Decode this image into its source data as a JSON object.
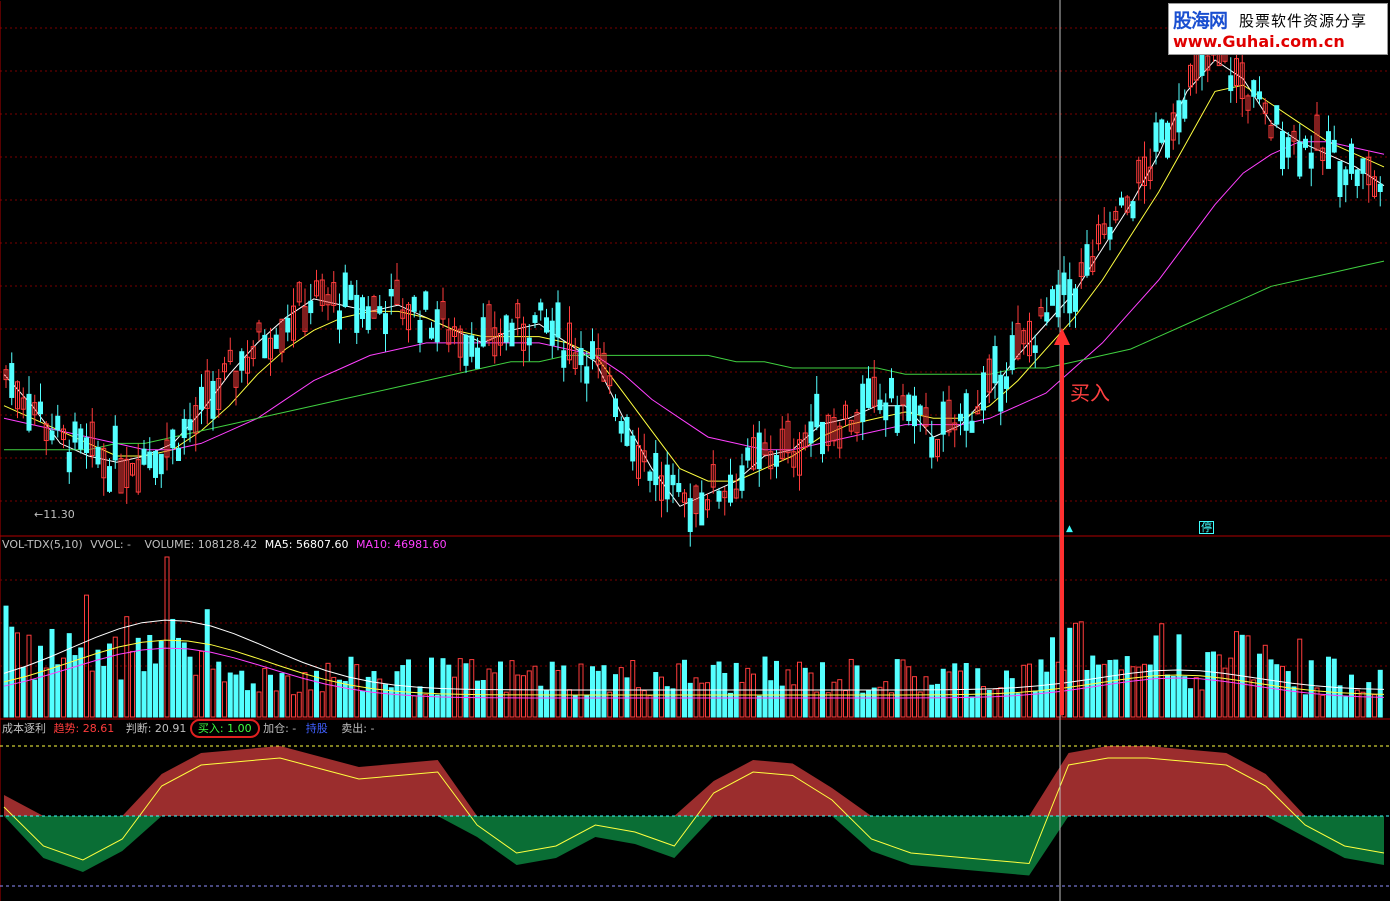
{
  "watermark": {
    "brand": "股海网",
    "tagline": "股票软件资源分享",
    "url": "www.Guhai.com.cn"
  },
  "annotations": {
    "buy_arrow_label": "买入",
    "low_price_label": "←11.30",
    "limit_mark": "停",
    "up_mark": "▲"
  },
  "volume_panel": {
    "name": "VOL-TDX(5,10)",
    "vvol": "VVOL: -",
    "volume": "VOLUME: 108128.42",
    "ma5": "MA5: 56807.60",
    "ma10": "MA10: 46981.60"
  },
  "indicator_panel": {
    "name": "成本逐利",
    "trend_label": "趋势: 28.61",
    "judge_label": "判断: 20.91",
    "buy_label": "买入: 1.00",
    "add_label": "加仓: -",
    "hold_label": "持股",
    "sell_label": "卖出: -"
  },
  "colors": {
    "background": "#000000",
    "up_candle": "#ff3c3c",
    "down_candle": "#54ffff",
    "ma_white": "#ffffff",
    "ma_yellow": "#ffff40",
    "ma_magenta": "#ff40ff",
    "ma_green": "#40d040",
    "grid": "#7a0000",
    "positive_fill": "#9b2d2d",
    "negative_fill": "#0a6e35"
  },
  "chart_data": [
    {
      "type": "candlestick",
      "title": "",
      "price_low_marked": 11.3,
      "series": [
        {
          "name": "MA-white",
          "values": [
            0.85,
            0.8,
            0.74,
            0.72,
            0.71,
            0.72,
            0.74,
            0.79,
            0.85,
            0.9,
            0.94,
            0.97,
            0.96,
            0.95,
            0.96,
            0.94,
            0.92,
            0.9,
            0.92,
            0.93,
            0.9,
            0.87,
            0.78,
            0.7,
            0.64,
            0.66,
            0.68,
            0.72,
            0.73,
            0.77,
            0.78,
            0.8,
            0.8,
            0.75,
            0.77,
            0.82,
            0.88,
            0.93,
            0.98,
            1.05,
            1.12,
            1.2,
            1.3,
            1.35,
            1.32,
            1.25,
            1.22,
            1.2,
            1.18,
            1.15
          ]
        },
        {
          "name": "MA-yellow",
          "values": [
            0.8,
            0.78,
            0.76,
            0.74,
            0.72,
            0.72,
            0.73,
            0.76,
            0.8,
            0.85,
            0.89,
            0.92,
            0.94,
            0.95,
            0.95,
            0.94,
            0.92,
            0.91,
            0.91,
            0.91,
            0.9,
            0.88,
            0.82,
            0.76,
            0.7,
            0.68,
            0.68,
            0.7,
            0.72,
            0.75,
            0.77,
            0.78,
            0.79,
            0.78,
            0.78,
            0.8,
            0.84,
            0.89,
            0.94,
            1.0,
            1.07,
            1.14,
            1.22,
            1.3,
            1.31,
            1.28,
            1.25,
            1.22,
            1.2,
            1.18
          ]
        },
        {
          "name": "MA-magenta",
          "values": [
            0.78,
            0.77,
            0.76,
            0.75,
            0.74,
            0.73,
            0.73,
            0.74,
            0.76,
            0.78,
            0.81,
            0.84,
            0.86,
            0.88,
            0.89,
            0.9,
            0.9,
            0.9,
            0.9,
            0.9,
            0.89,
            0.88,
            0.85,
            0.81,
            0.78,
            0.75,
            0.74,
            0.73,
            0.73,
            0.74,
            0.75,
            0.76,
            0.77,
            0.77,
            0.77,
            0.78,
            0.8,
            0.82,
            0.86,
            0.9,
            0.95,
            1.0,
            1.06,
            1.12,
            1.17,
            1.2,
            1.22,
            1.22,
            1.21,
            1.2
          ]
        },
        {
          "name": "MA-green",
          "values": [
            0.73,
            0.73,
            0.73,
            0.73,
            0.74,
            0.74,
            0.75,
            0.76,
            0.77,
            0.78,
            0.79,
            0.8,
            0.81,
            0.82,
            0.83,
            0.84,
            0.85,
            0.86,
            0.87,
            0.87,
            0.88,
            0.88,
            0.88,
            0.88,
            0.88,
            0.88,
            0.87,
            0.87,
            0.86,
            0.86,
            0.86,
            0.86,
            0.85,
            0.85,
            0.85,
            0.85,
            0.86,
            0.86,
            0.87,
            0.88,
            0.89,
            0.91,
            0.93,
            0.95,
            0.97,
            0.99,
            1.0,
            1.01,
            1.02,
            1.03
          ]
        }
      ]
    },
    {
      "type": "bar",
      "title": "VOL-TDX(5,10)",
      "last_volume": 108128.42,
      "ma5": 56807.6,
      "ma10": 46981.6
    },
    {
      "type": "area",
      "title": "成本逐利",
      "trend": 28.61,
      "judge": 20.91,
      "buy": 1.0
    }
  ]
}
